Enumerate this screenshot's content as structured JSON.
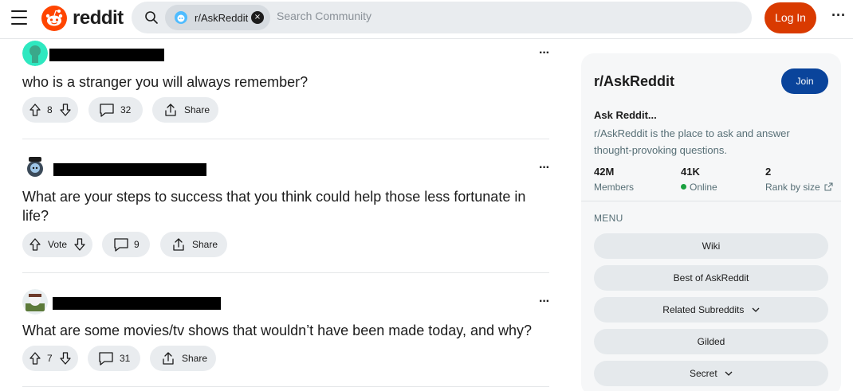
{
  "header": {
    "wordmark": "reddit",
    "community_chip": "r/AskReddit",
    "chip_close": "×",
    "search_placeholder": "Search Community",
    "login": "Log In",
    "more": "•••"
  },
  "posts": [
    {
      "title": "who is a stranger you will always remember?",
      "votes": "8",
      "comments": "32",
      "share": "Share",
      "more": "•••"
    },
    {
      "title": "What are your steps to success that you think could help those less fortunate in life?",
      "votes": "Vote",
      "comments": "9",
      "share": "Share",
      "more": "•••"
    },
    {
      "title": "What are some movies/tv shows that wouldn’t have been made today, and why?",
      "votes": "7",
      "comments": "31",
      "share": "Share",
      "more": "•••"
    }
  ],
  "sidebar": {
    "name": "r/AskReddit",
    "join": "Join",
    "tagline": "Ask Reddit...",
    "description": "r/AskReddit is the place to ask and answer thought-provoking questions.",
    "stats": [
      {
        "value": "42M",
        "label": "Members"
      },
      {
        "value": "41K",
        "label": "Online"
      },
      {
        "value": "2",
        "label": "Rank by size"
      }
    ],
    "menu_heading": "MENU",
    "menu_items": [
      {
        "label": "Wiki"
      },
      {
        "label": "Best of AskReddit"
      },
      {
        "label": "Related Subreddits"
      },
      {
        "label": "Gilded"
      },
      {
        "label": "Secret"
      }
    ]
  },
  "colors": {
    "brand": "#ff4500",
    "login": "#d93a00",
    "join": "#0a449b",
    "online": "#1aa03f"
  }
}
